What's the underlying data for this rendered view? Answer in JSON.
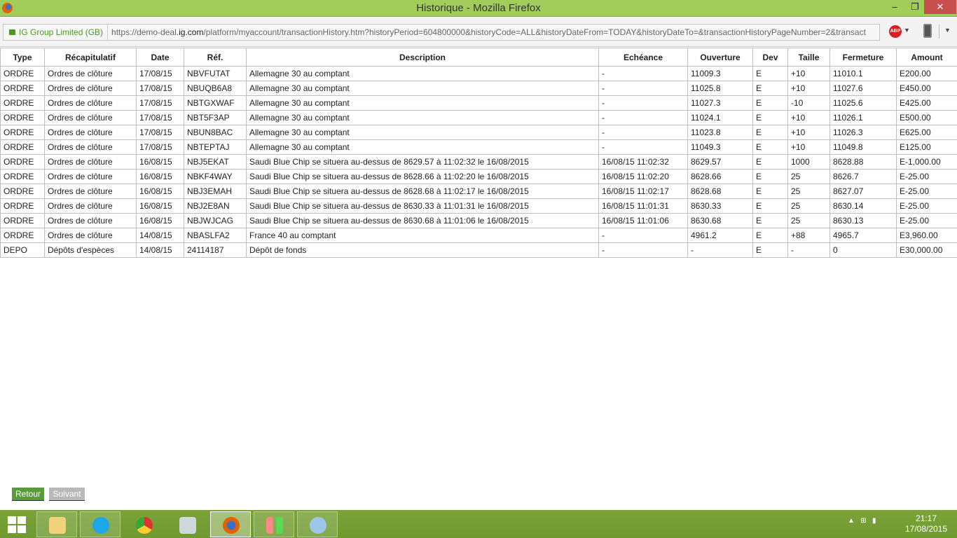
{
  "window": {
    "title": "Historique - Mozilla Firefox",
    "min": "‒",
    "max": "❐",
    "close": "✕"
  },
  "navbar": {
    "identity": "IG Group Limited (GB)",
    "url_pre": "https://demo-deal.",
    "url_domain": "ig.com",
    "url_post": "/platform/myaccount/transactionHistory.htm?historyPeriod=604800000&historyCode=ALL&historyDateFrom=TODAY&historyDateTo=&transactionHistoryPageNumber=2&transact",
    "abp": "ABP"
  },
  "table": {
    "headers": [
      "Type",
      "Récapitulatif",
      "Date",
      "Réf.",
      "Description",
      "Echéance",
      "Ouverture",
      "Dev",
      "Taille",
      "Fermeture",
      "Amount"
    ],
    "rows": [
      [
        "ORDRE",
        "Ordres de clôture",
        "17/08/15",
        "NBVFUTAT",
        "Allemagne 30 au comptant",
        "-",
        "11009.3",
        "E",
        "+10",
        "11010.1",
        "E200.00"
      ],
      [
        "ORDRE",
        "Ordres de clôture",
        "17/08/15",
        "NBUQB6A8",
        "Allemagne 30 au comptant",
        "-",
        "11025.8",
        "E",
        "+10",
        "11027.6",
        "E450.00"
      ],
      [
        "ORDRE",
        "Ordres de clôture",
        "17/08/15",
        "NBTGXWAF",
        "Allemagne 30 au comptant",
        "-",
        "11027.3",
        "E",
        "-10",
        "11025.6",
        "E425.00"
      ],
      [
        "ORDRE",
        "Ordres de clôture",
        "17/08/15",
        "NBT5F3AP",
        "Allemagne 30 au comptant",
        "-",
        "11024.1",
        "E",
        "+10",
        "11026.1",
        "E500.00"
      ],
      [
        "ORDRE",
        "Ordres de clôture",
        "17/08/15",
        "NBUN8BAC",
        "Allemagne 30 au comptant",
        "-",
        "11023.8",
        "E",
        "+10",
        "11026.3",
        "E625.00"
      ],
      [
        "ORDRE",
        "Ordres de clôture",
        "17/08/15",
        "NBTEPTAJ",
        "Allemagne 30 au comptant",
        "-",
        "11049.3",
        "E",
        "+10",
        "11049.8",
        "E125.00"
      ],
      [
        "ORDRE",
        "Ordres de clôture",
        "16/08/15",
        "NBJ5EKAT",
        "Saudi Blue Chip se situera au-dessus de 8629.57 à 11:02:32 le 16/08/2015",
        "16/08/15 11:02:32",
        "8629.57",
        "E",
        "1000",
        "8628.88",
        "E-1,000.00"
      ],
      [
        "ORDRE",
        "Ordres de clôture",
        "16/08/15",
        "NBKF4WAY",
        "Saudi Blue Chip se situera au-dessus de 8628.66 à 11:02:20 le 16/08/2015",
        "16/08/15 11:02:20",
        "8628.66",
        "E",
        "25",
        "8626.7",
        "E-25.00"
      ],
      [
        "ORDRE",
        "Ordres de clôture",
        "16/08/15",
        "NBJ3EMAH",
        "Saudi Blue Chip se situera au-dessus de 8628.68 à 11:02:17 le 16/08/2015",
        "16/08/15 11:02:17",
        "8628.68",
        "E",
        "25",
        "8627.07",
        "E-25.00"
      ],
      [
        "ORDRE",
        "Ordres de clôture",
        "16/08/15",
        "NBJ2E8AN",
        "Saudi Blue Chip se situera au-dessus de 8630.33 à 11:01:31 le 16/08/2015",
        "16/08/15 11:01:31",
        "8630.33",
        "E",
        "25",
        "8630.14",
        "E-25.00"
      ],
      [
        "ORDRE",
        "Ordres de clôture",
        "16/08/15",
        "NBJWJCAG",
        "Saudi Blue Chip se situera au-dessus de 8630.68 à 11:01:06 le 16/08/2015",
        "16/08/15 11:01:06",
        "8630.68",
        "E",
        "25",
        "8630.13",
        "E-25.00"
      ],
      [
        "ORDRE",
        "Ordres de clôture",
        "14/08/15",
        "NBASLFA2",
        "France 40 au comptant",
        "-",
        "4961.2",
        "E",
        "+88",
        "4965.7",
        "E3,960.00"
      ],
      [
        "DEPO",
        "Dépôts d'espèces",
        "14/08/15",
        "24114187",
        "Dépôt de fonds",
        "-",
        "-",
        "E",
        "-",
        "0",
        "E30,000.00"
      ]
    ]
  },
  "pager": {
    "back": "Retour",
    "next": "Suivant"
  },
  "taskbar": {
    "items": [
      "file-explorer",
      "skype",
      "chrome",
      "resource-monitor",
      "firefox",
      "trading-chart",
      "paint"
    ],
    "time": "21:17",
    "date": "17/08/2015"
  }
}
